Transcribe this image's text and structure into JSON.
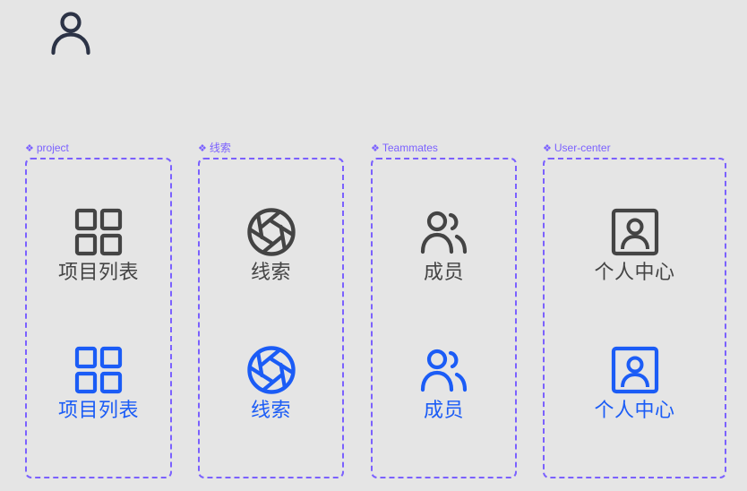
{
  "colors": {
    "background": "#e5e5e5",
    "frame": "#7b61ff",
    "default": "#444444",
    "selected": "#1b5cf6",
    "user_icon": "#2c3346"
  },
  "header": {
    "avatar_icon": "user-icon"
  },
  "component_sets": [
    {
      "name": "project",
      "icon": "grid-icon",
      "variants": [
        {
          "state": "default",
          "label": "项目列表"
        },
        {
          "state": "selected",
          "label": "项目列表"
        }
      ]
    },
    {
      "name": "线索",
      "icon": "aperture-icon",
      "variants": [
        {
          "state": "default",
          "label": "线索"
        },
        {
          "state": "selected",
          "label": "线索"
        }
      ]
    },
    {
      "name": "Teammates",
      "icon": "users-icon",
      "variants": [
        {
          "state": "default",
          "label": "成员"
        },
        {
          "state": "selected",
          "label": "成员"
        }
      ]
    },
    {
      "name": "User-center",
      "icon": "user-card-icon",
      "variants": [
        {
          "state": "default",
          "label": "个人中心"
        },
        {
          "state": "selected",
          "label": "个人中心"
        }
      ]
    }
  ]
}
